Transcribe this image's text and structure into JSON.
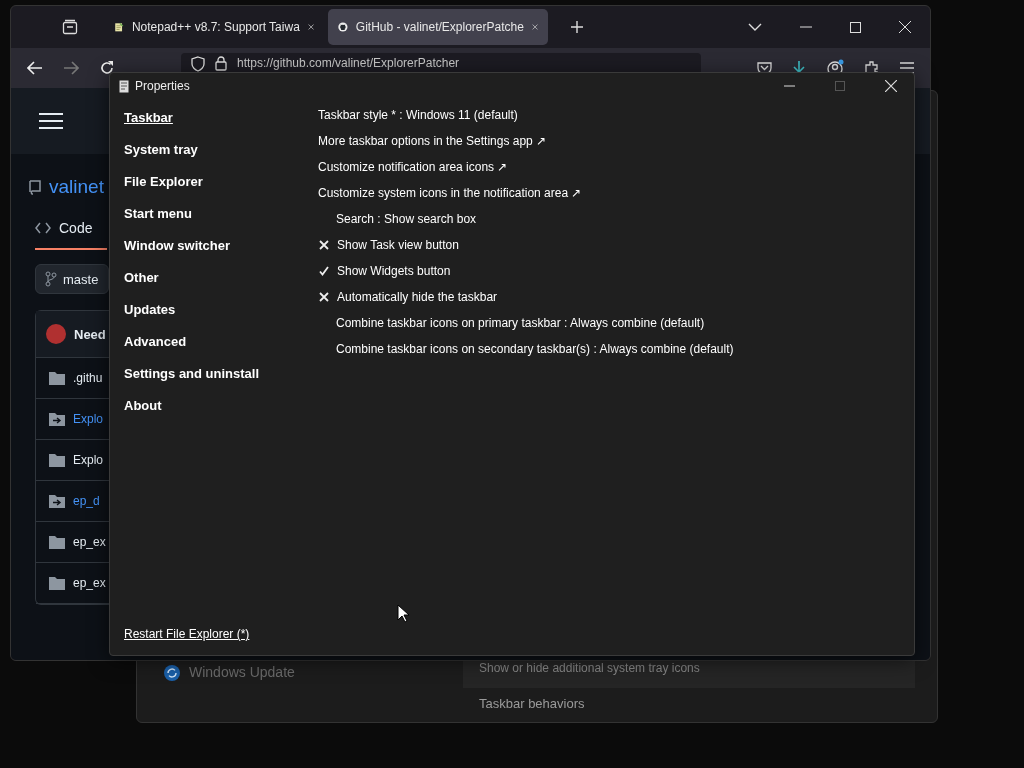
{
  "browser": {
    "tabs": [
      {
        "title": "Notepad++ v8.7: Support Taiwa",
        "selected": false,
        "kind": "notepad"
      },
      {
        "title": "GitHub - valinet/ExplorerPatche",
        "selected": true,
        "kind": "github"
      }
    ],
    "url": "https://github.com/valinet/ExplorerPatcher",
    "page": {
      "repo": "valinet",
      "code_tab": "Code",
      "branch": "maste",
      "commit_author": "Need",
      "files": [
        {
          "name": ".githu",
          "kind": "folder"
        },
        {
          "name": "Explo",
          "kind": "submodule"
        },
        {
          "name": "Explo",
          "kind": "folder"
        },
        {
          "name": "ep_d",
          "kind": "submodule"
        },
        {
          "name": "ep_ex",
          "kind": "folder"
        },
        {
          "name": "ep_ex",
          "kind": "folder"
        }
      ]
    }
  },
  "settings_window": {
    "nav_item": "Windows Update",
    "setting_hint": "Show or hide additional system tray icons",
    "section": "Taskbar behaviors"
  },
  "properties": {
    "title": "Properties",
    "nav": [
      {
        "label": "Taskbar",
        "selected": true
      },
      {
        "label": "System tray",
        "selected": false
      },
      {
        "label": "File Explorer",
        "selected": false
      },
      {
        "label": "Start menu",
        "selected": false
      },
      {
        "label": "Window switcher",
        "selected": false
      },
      {
        "label": "Other",
        "selected": false
      },
      {
        "label": "Updates",
        "selected": false
      },
      {
        "label": "Advanced",
        "selected": false
      },
      {
        "label": "Settings and uninstall",
        "selected": false
      },
      {
        "label": "About",
        "selected": false
      }
    ],
    "options": [
      {
        "kind": "plain",
        "label": "Taskbar style * : Windows 11 (default)"
      },
      {
        "kind": "link",
        "label": "More taskbar options in the Settings app ↗"
      },
      {
        "kind": "link",
        "label": "Customize notification area icons ↗"
      },
      {
        "kind": "link",
        "label": "Customize system icons in the notification area ↗"
      },
      {
        "kind": "choice",
        "label": "Search : Show search box"
      },
      {
        "kind": "toggle",
        "label": "Show Task view button",
        "checked": false
      },
      {
        "kind": "toggle",
        "label": "Show Widgets button",
        "checked": true
      },
      {
        "kind": "toggle",
        "label": "Automatically hide the taskbar",
        "checked": false
      },
      {
        "kind": "choice",
        "label": "Combine taskbar icons on primary taskbar : Always combine (default)"
      },
      {
        "kind": "choice",
        "label": "Combine taskbar icons on secondary taskbar(s) : Always combine (default)"
      }
    ],
    "footer_link": "Restart File Explorer (*)"
  }
}
